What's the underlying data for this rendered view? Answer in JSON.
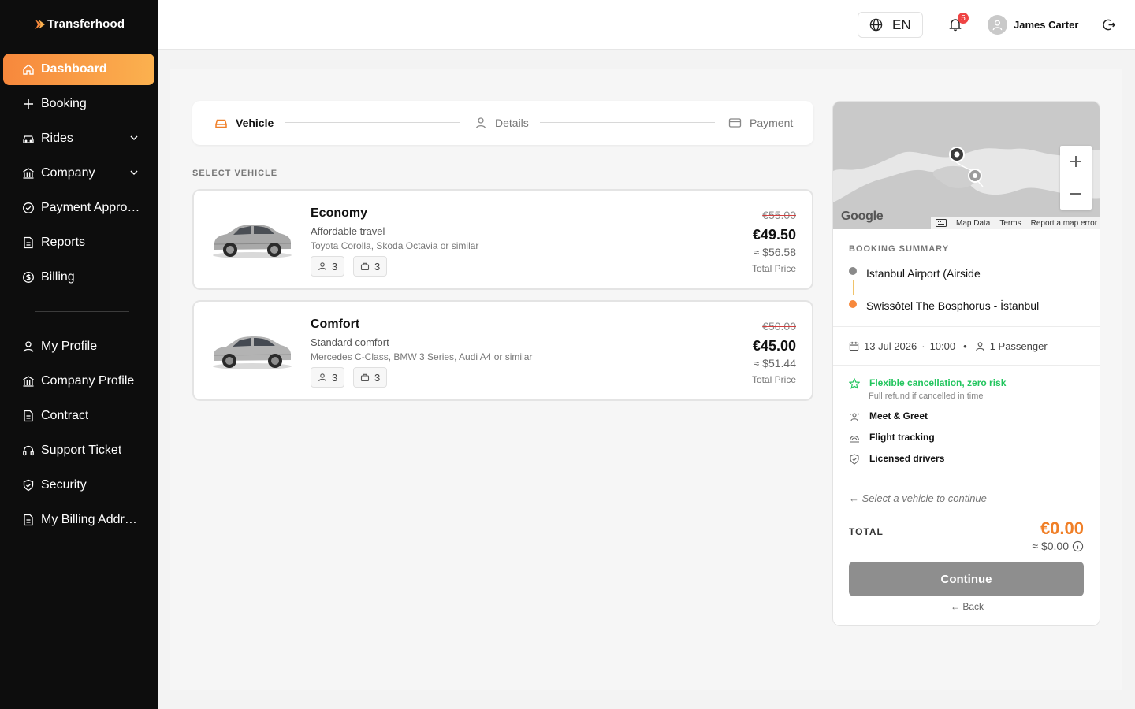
{
  "app": {
    "logo_text": "Transferhood",
    "brand_color": "#f7883c"
  },
  "sidebar": {
    "items": [
      {
        "label": "Dashboard",
        "icon": "home-icon",
        "active": true
      },
      {
        "label": "Booking",
        "icon": "plus-icon"
      },
      {
        "label": "Rides",
        "icon": "car-icon",
        "has_chevron": true
      },
      {
        "label": "Company",
        "icon": "building-icon",
        "has_chevron": true
      },
      {
        "label": "Payment Approvals",
        "icon": "check-circle-icon"
      },
      {
        "label": "Reports",
        "icon": "document-icon"
      },
      {
        "label": "Billing",
        "icon": "dollar-icon"
      }
    ],
    "account_items": [
      {
        "label": "My Profile",
        "icon": "user-icon"
      },
      {
        "label": "Company Profile",
        "icon": "building-icon"
      },
      {
        "label": "Contract",
        "icon": "document-icon"
      },
      {
        "label": "Support Ticket",
        "icon": "headset-icon"
      },
      {
        "label": "Security",
        "icon": "shield-icon"
      },
      {
        "label": "My Billing Address",
        "icon": "document-icon"
      }
    ]
  },
  "topbar": {
    "language": "EN",
    "notification_count": "5",
    "user_name": "James Carter"
  },
  "stepper": {
    "steps": [
      {
        "label": "Vehicle",
        "icon": "car-icon",
        "active": true
      },
      {
        "label": "Details",
        "icon": "user-icon",
        "active": false
      },
      {
        "label": "Payment",
        "icon": "card-icon",
        "active": false
      }
    ]
  },
  "vehicles": {
    "section_title": "SELECT VEHICLE",
    "items": [
      {
        "name": "Economy",
        "subtitle": "Affordable travel",
        "models": "Toyota Corolla, Skoda Octavia or similar",
        "passengers": "3",
        "luggage": "3",
        "old_price": "€55.00",
        "price": "€49.50",
        "usd_price": "≈ $56.58",
        "price_label": "Total Price"
      },
      {
        "name": "Comfort",
        "subtitle": "Standard comfort",
        "models": "Mercedes C-Class, BMW 3 Series, Audi A4 or similar",
        "passengers": "3",
        "luggage": "3",
        "old_price": "€50.00",
        "price": "€45.00",
        "usd_price": "≈ $51.44",
        "price_label": "Total Price"
      }
    ]
  },
  "map": {
    "attribution": "Google",
    "map_data": "Map Data",
    "terms": "Terms",
    "report": "Report a map error"
  },
  "summary": {
    "title": "BOOKING SUMMARY",
    "from": "Istanbul Airport (Airside",
    "to": "Swissôtel The Bosphorus - İstanbul",
    "date": "13 Jul 2026",
    "time": "10:00",
    "passengers": "1 Passenger",
    "features": {
      "cancellation_title": "Flexible cancellation, zero risk",
      "cancellation_sub": "Full refund if cancelled in time",
      "meet": "Meet & Greet",
      "flight": "Flight tracking",
      "licensed": "Licensed drivers"
    },
    "hint": "← Select a vehicle to continue",
    "total_label": "TOTAL",
    "total_eur": "€0.00",
    "total_usd": "≈ $0.00",
    "continue_label": "Continue",
    "back_label": "← Back"
  }
}
